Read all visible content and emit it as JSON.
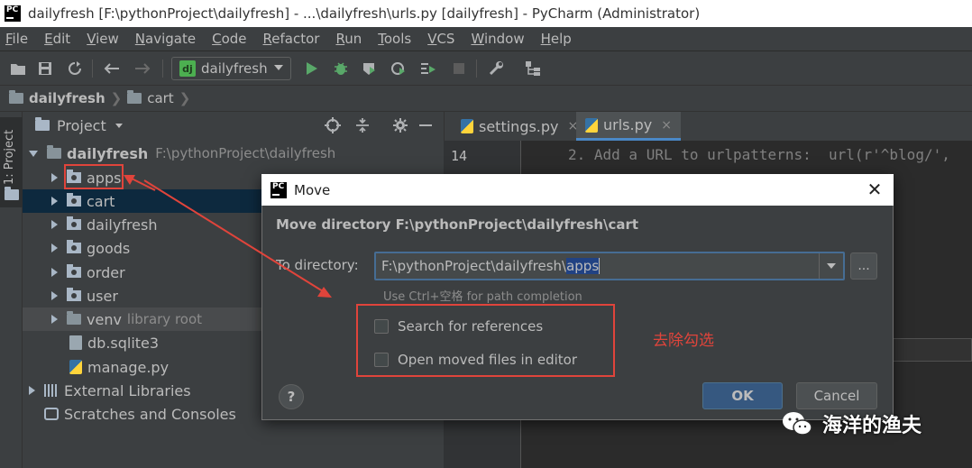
{
  "window": {
    "title": "dailyfresh [F:\\pythonProject\\dailyfresh] - ...\\dailyfresh\\urls.py [dailyfresh] - PyCharm (Administrator)"
  },
  "menu": [
    {
      "mnemonic": "F",
      "rest": "ile"
    },
    {
      "mnemonic": "E",
      "rest": "dit"
    },
    {
      "mnemonic": "V",
      "rest": "iew"
    },
    {
      "mnemonic": "N",
      "rest": "avigate"
    },
    {
      "mnemonic": "C",
      "rest": "ode"
    },
    {
      "mnemonic": "R",
      "rest": "efactor"
    },
    {
      "mnemonic": "R",
      "rest": "un"
    },
    {
      "mnemonic": "T",
      "rest": "ools"
    },
    {
      "mnemonic": "V",
      "rest": "CS"
    },
    {
      "mnemonic": "W",
      "rest": "indow"
    },
    {
      "mnemonic": "H",
      "rest": "elp"
    }
  ],
  "toolbar": {
    "run_config": "dailyfresh",
    "run_config_icon": "dj"
  },
  "breadcrumb": [
    "dailyfresh",
    "cart"
  ],
  "left_stripe": {
    "label": "1: Project"
  },
  "project_panel": {
    "title": "Project",
    "root": {
      "name": "dailyfresh",
      "path": "F:\\pythonProject\\dailyfresh"
    },
    "items": [
      {
        "name": "apps",
        "type": "package",
        "selected": false
      },
      {
        "name": "cart",
        "type": "package",
        "selected": true
      },
      {
        "name": "dailyfresh",
        "type": "package",
        "selected": false
      },
      {
        "name": "goods",
        "type": "package",
        "selected": false
      },
      {
        "name": "order",
        "type": "package",
        "selected": false
      },
      {
        "name": "user",
        "type": "package",
        "selected": false
      },
      {
        "name": "venv",
        "suffix": "library root",
        "type": "folder",
        "selected": false
      },
      {
        "name": "db.sqlite3",
        "type": "file"
      },
      {
        "name": "manage.py",
        "type": "python"
      }
    ],
    "external_libraries": "External Libraries",
    "scratches": "Scratches and Consoles"
  },
  "editor": {
    "tabs": [
      {
        "label": "settings.py",
        "close": "×",
        "active": false
      },
      {
        "label": "urls.py",
        "close": "×",
        "active": true
      }
    ],
    "line_number": "14",
    "code_line": "2. Add a URL to urlpatterns:  url(r'^blog/',"
  },
  "dialog": {
    "title": "Move",
    "close": "✕",
    "heading": "Move directory F:\\pythonProject\\dailyfresh\\cart",
    "to_directory_label": "To directory:",
    "to_directory_value_prefix": "F:\\pythonProject\\dailyfresh\\",
    "to_directory_value_selected": "apps",
    "browse_label": "...",
    "hint": "Use Ctrl+空格 for path completion",
    "search_references_label": "Search for references",
    "search_references_checked": false,
    "open_in_editor_label": "Open moved files in editor",
    "open_in_editor_checked": false,
    "help_label": "?",
    "ok_label": "OK",
    "cancel_label": "Cancel"
  },
  "annotation": {
    "text": "去除勾选",
    "color": "#e0443b"
  },
  "watermark": {
    "text": "海洋的渔夫"
  },
  "colors": {
    "ide_background": "#2b2b2b",
    "panel_background": "#3c3f41",
    "selection": "#0d293e",
    "accent": "#4a88c7",
    "ok_button": "#365880"
  }
}
